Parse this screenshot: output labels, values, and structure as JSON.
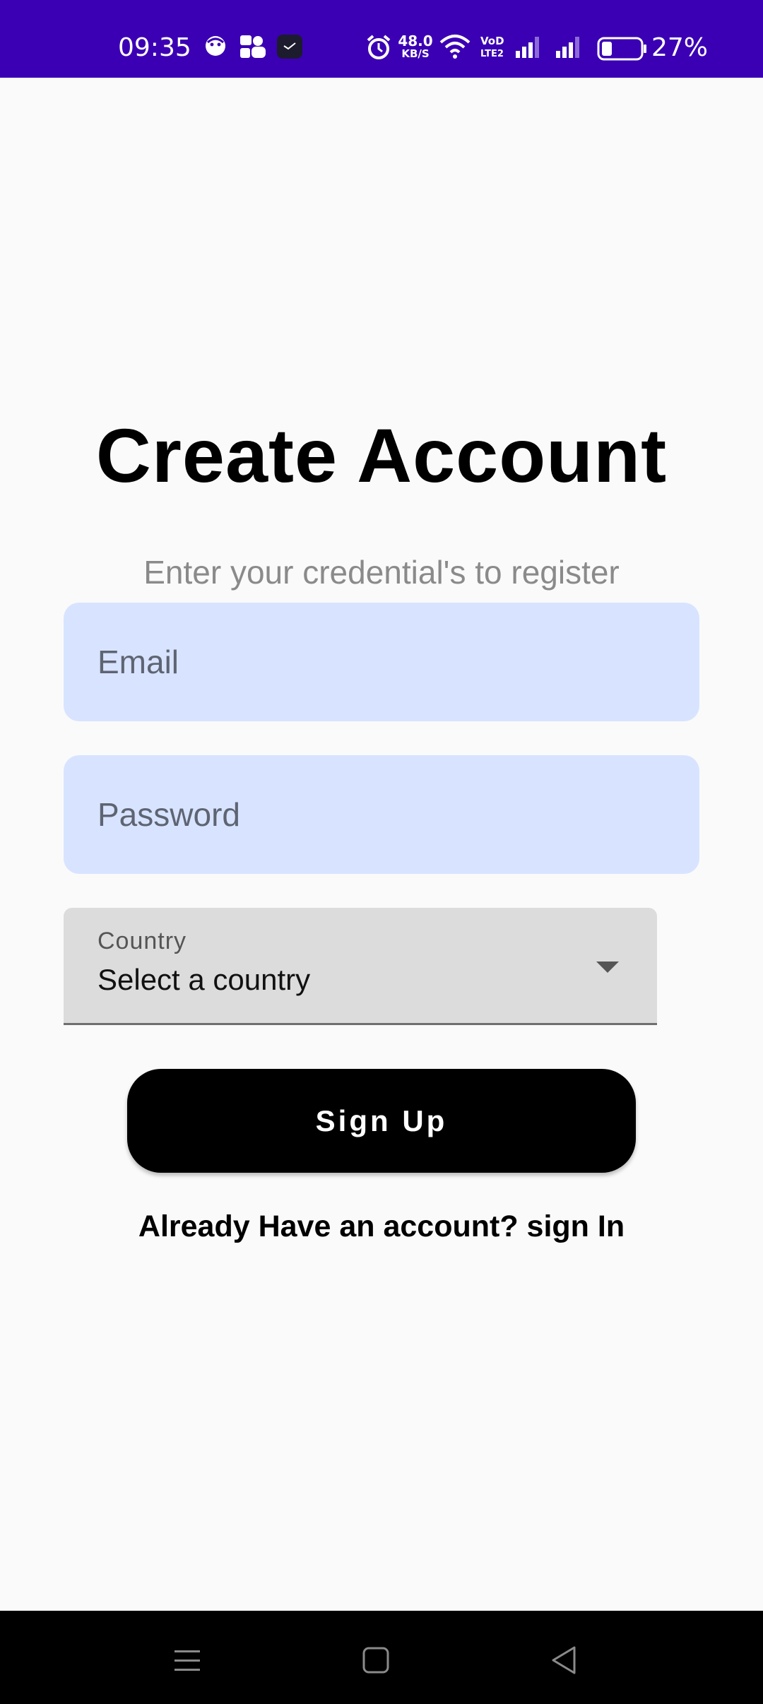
{
  "status_bar": {
    "time": "09:35",
    "net_speed_value": "48.0",
    "net_speed_unit": "KB/S",
    "battery_percent": "27%",
    "background_color": "#3b00b4",
    "icons": [
      "notification-face-icon",
      "notification-contacts-icon",
      "notification-app-icon",
      "alarm-icon",
      "wifi-icon",
      "volte-icon",
      "signal-icon",
      "signal-icon",
      "battery-icon"
    ]
  },
  "screen": {
    "title": "Create Account",
    "subtitle": "Enter your credential's to register",
    "email": {
      "placeholder": "Email",
      "value": ""
    },
    "password": {
      "placeholder": "Password",
      "value": ""
    },
    "country": {
      "label": "Country",
      "selected": "Select a country"
    },
    "signup_label": "Sign Up",
    "signin_link": "Already Have an account? sign In",
    "input_fill_color": "#d8e4ff",
    "button_color": "#000000"
  },
  "nav_bar": {
    "icons": [
      "menu-icon",
      "home-icon",
      "back-icon"
    ]
  }
}
